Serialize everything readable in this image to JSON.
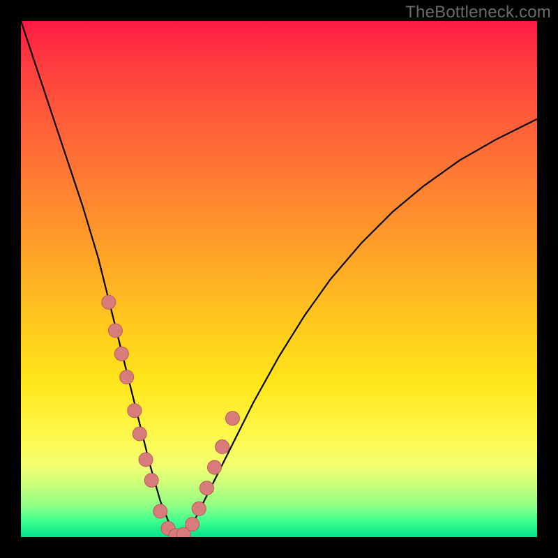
{
  "watermark": "TheBottleneck.com",
  "chart_data": {
    "type": "line",
    "title": "",
    "xlabel": "",
    "ylabel": "",
    "xlim": [
      0,
      100
    ],
    "ylim": [
      0,
      100
    ],
    "grid": false,
    "series": [
      {
        "name": "bottleneck-curve",
        "x": [
          0,
          3,
          6,
          9,
          12,
          15,
          17,
          19,
          21,
          23,
          25,
          27,
          29,
          31,
          33,
          36,
          40,
          45,
          50,
          55,
          60,
          66,
          72,
          78,
          85,
          92,
          100
        ],
        "y": [
          100,
          91,
          82,
          73,
          64,
          54,
          46,
          38,
          30,
          22,
          14,
          7,
          2,
          0,
          2,
          8,
          16,
          26,
          35,
          43,
          50,
          57,
          63,
          68,
          73,
          77,
          81
        ]
      }
    ],
    "markers": {
      "name": "highlight-points",
      "color": "#d77b7b",
      "x": [
        17.0,
        18.3,
        19.5,
        20.5,
        22.0,
        23.0,
        24.2,
        25.3,
        27.0,
        28.5,
        30.0,
        31.5,
        33.2,
        34.5,
        36.0,
        37.5,
        39.0,
        41.0
      ],
      "y": [
        45.5,
        40.0,
        35.5,
        31.0,
        24.5,
        20.0,
        15.0,
        11.0,
        5.0,
        1.7,
        0.3,
        0.5,
        2.5,
        5.5,
        9.5,
        13.5,
        17.5,
        23.0
      ]
    },
    "colors": {
      "curve": "#000000",
      "markers_fill": "#d77b7b",
      "markers_stroke": "#b85a5a",
      "gradient_top": "#ff1a44",
      "gradient_bottom": "#00e28a",
      "frame": "#000000"
    }
  }
}
